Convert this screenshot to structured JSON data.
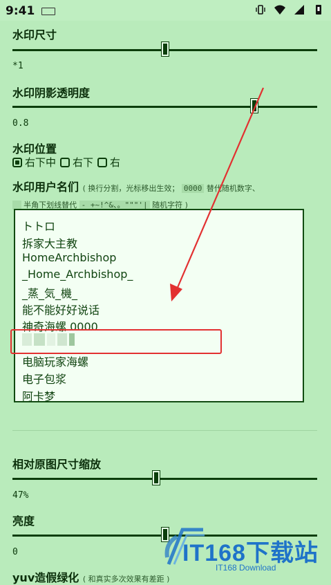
{
  "status": {
    "time": "9:41"
  },
  "sections": {
    "size": {
      "title": "水印尺寸",
      "value": "*1",
      "level": 0.5
    },
    "opacity": {
      "title": "水印阴影透明度",
      "value": "0.8",
      "level": 0.8
    },
    "position": {
      "title": "水印位置",
      "options": [
        {
          "label": "右下中",
          "checked": true
        },
        {
          "label": "右下",
          "checked": false
        },
        {
          "label": "右",
          "checked": false
        }
      ]
    },
    "username": {
      "title": "水印用户名们",
      "hint_1a": "( 换行分割，光标移出生效； ",
      "hint_1b": "0000",
      "hint_1c": " 替代随机数字、",
      "hint_2a": "_",
      "hint_2b": " 半角下划线替代 ",
      "hint_2c": "-_+~!^&、。\"\"\"'|",
      "hint_2d": " 随机字符 )",
      "items": [
        "トトロ",
        "拆家大主教",
        "HomeArchbishop",
        "_Home_Archbishop_",
        "_蒸_気_機_",
        "能不能好好说话",
        "神奇海螺 0000",
        "",
        "电脑玩家海螺",
        "电子包浆",
        "阿卡梦"
      ]
    },
    "scale": {
      "title": "相对原图尺寸缩放",
      "value": "47%",
      "level": 0.47
    },
    "brightness": {
      "title": "亮度",
      "value": "0",
      "level": 0.5
    },
    "yuv": {
      "title": "yuv造假绿化",
      "hint": "( 和真实多次效果有差距 )"
    }
  },
  "watermark": {
    "brand": "IT168下载站",
    "sub": "IT168 Download"
  },
  "colors": {
    "background": "#b9ebbb",
    "accent": "#0b3d0b",
    "highlight": "#e23030",
    "brand": "#1f73c9"
  }
}
